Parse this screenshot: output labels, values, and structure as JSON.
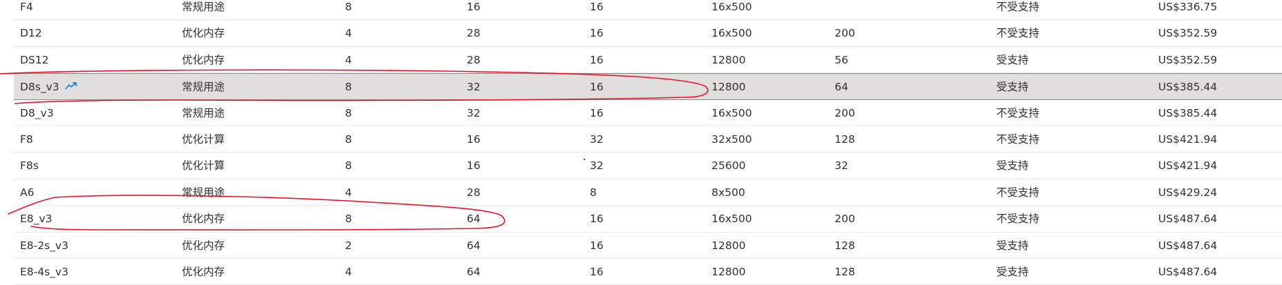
{
  "table": {
    "rows": [
      {
        "name": "F4",
        "category": "常规用途",
        "vcpu": "8",
        "memory": "16",
        "disks": "16",
        "iops": "16x500",
        "temp": "",
        "premium": "不受支持",
        "price": "US$336.75",
        "selected": false,
        "trend": false
      },
      {
        "name": "D12",
        "category": "优化内存",
        "vcpu": "4",
        "memory": "28",
        "disks": "16",
        "iops": "16x500",
        "temp": "200",
        "premium": "不受支持",
        "price": "US$352.59",
        "selected": false,
        "trend": false
      },
      {
        "name": "DS12",
        "category": "优化内存",
        "vcpu": "4",
        "memory": "28",
        "disks": "16",
        "iops": "12800",
        "temp": "56",
        "premium": "受支持",
        "price": "US$352.59",
        "selected": false,
        "trend": false
      },
      {
        "name": "D8s_v3",
        "category": "常规用途",
        "vcpu": "8",
        "memory": "32",
        "disks": "16",
        "iops": "12800",
        "temp": "64",
        "premium": "受支持",
        "price": "US$385.44",
        "selected": true,
        "trend": true
      },
      {
        "name": "D8_v3",
        "category": "常规用途",
        "vcpu": "8",
        "memory": "32",
        "disks": "16",
        "iops": "16x500",
        "temp": "200",
        "premium": "不受支持",
        "price": "US$385.44",
        "selected": false,
        "trend": false
      },
      {
        "name": "F8",
        "category": "优化计算",
        "vcpu": "8",
        "memory": "16",
        "disks": "32",
        "iops": "32x500",
        "temp": "128",
        "premium": "不受支持",
        "price": "US$421.94",
        "selected": false,
        "trend": false
      },
      {
        "name": "F8s",
        "category": "优化计算",
        "vcpu": "8",
        "memory": "16",
        "disks": "32",
        "iops": "25600",
        "temp": "32",
        "premium": "受支持",
        "price": "US$421.94",
        "selected": false,
        "trend": false
      },
      {
        "name": "A6",
        "category": "常规用途",
        "vcpu": "4",
        "memory": "28",
        "disks": "8",
        "iops": "8x500",
        "temp": "",
        "premium": "不受支持",
        "price": "US$429.24",
        "selected": false,
        "trend": false
      },
      {
        "name": "E8_v3",
        "category": "优化内存",
        "vcpu": "8",
        "memory": "64",
        "disks": "16",
        "iops": "16x500",
        "temp": "200",
        "premium": "不受支持",
        "price": "US$487.64",
        "selected": false,
        "trend": false
      },
      {
        "name": "E8-2s_v3",
        "category": "优化内存",
        "vcpu": "2",
        "memory": "64",
        "disks": "16",
        "iops": "12800",
        "temp": "128",
        "premium": "受支持",
        "price": "US$487.64",
        "selected": false,
        "trend": false
      },
      {
        "name": "E8-4s_v3",
        "category": "优化内存",
        "vcpu": "4",
        "memory": "64",
        "disks": "16",
        "iops": "12800",
        "temp": "128",
        "premium": "受支持",
        "price": "US$487.64",
        "selected": false,
        "trend": false
      }
    ]
  },
  "colors": {
    "text": "#323130",
    "selected_row_bg": "#e1dfdd",
    "row_border": "#edebe9",
    "trend_icon": "#0078d4",
    "annotation_stroke": "#e81123"
  },
  "icons": {
    "trend": "trending-up-icon"
  }
}
